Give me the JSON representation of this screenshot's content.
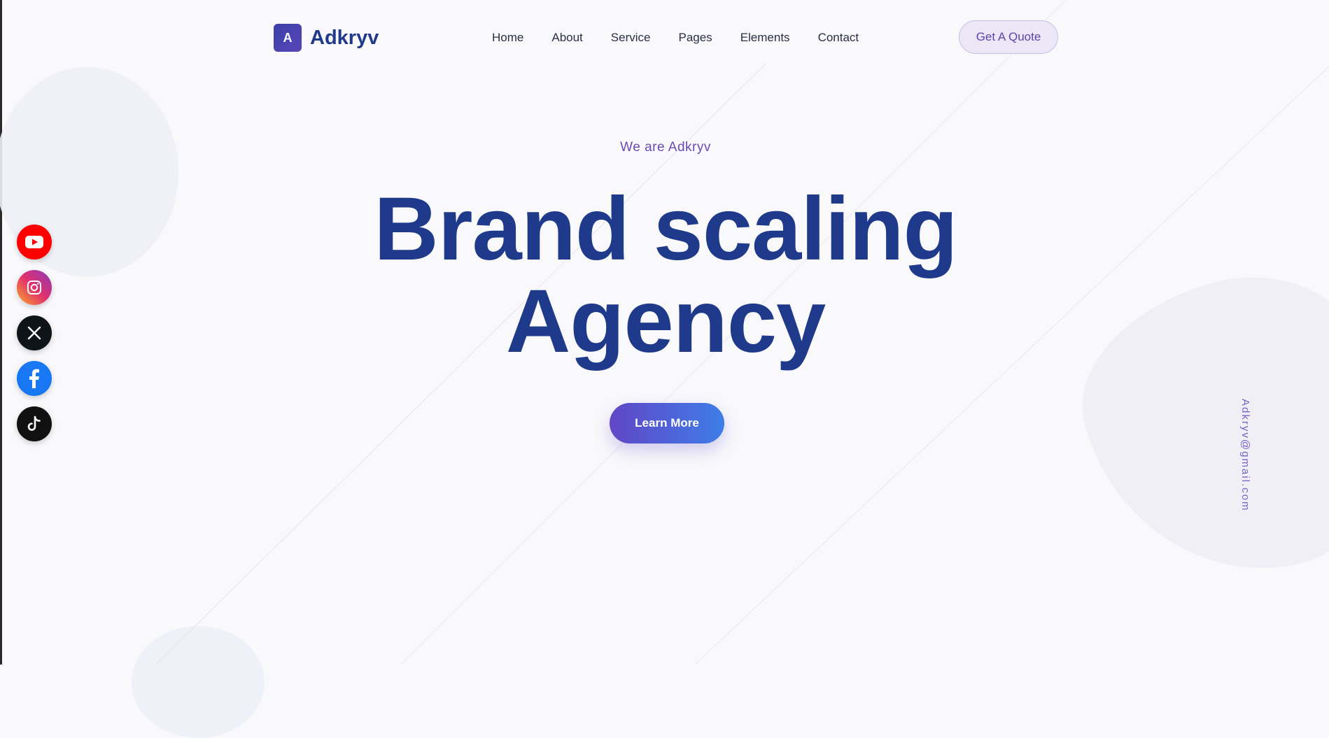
{
  "brand": {
    "logo_letter": "A",
    "name": "Adkryv"
  },
  "nav": [
    "Home",
    "About",
    "Service",
    "Pages",
    "Elements",
    "Contact"
  ],
  "header_button": "Get A Quote",
  "hero": {
    "tagline": "We are Adkryv",
    "headline_line1": "Brand scaling",
    "headline_line2": "Agency",
    "cta": "Learn More"
  },
  "email": "Adkryv@gmail.com",
  "social": [
    {
      "name": "youtube-icon",
      "color": "#ff0000"
    },
    {
      "name": "instagram-icon",
      "color": "#e1306c"
    },
    {
      "name": "x-icon",
      "color": "#0f1419"
    },
    {
      "name": "facebook-icon",
      "color": "#1877f2"
    },
    {
      "name": "tiktok-icon",
      "color": "#111111"
    }
  ]
}
